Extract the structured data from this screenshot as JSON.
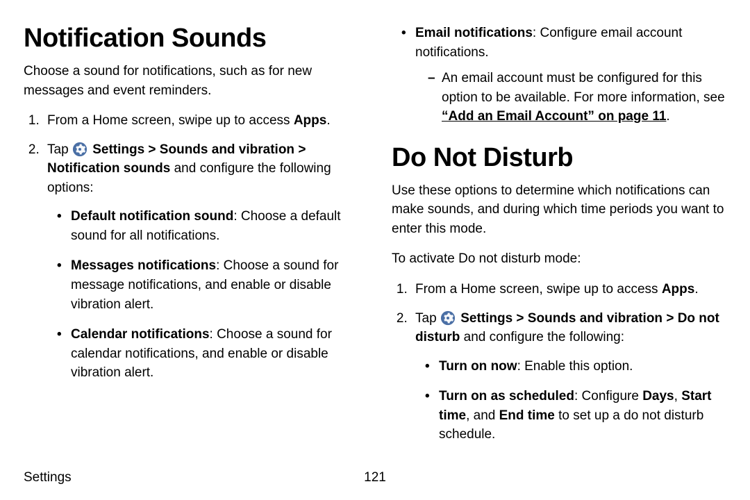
{
  "left": {
    "title": "Notification Sounds",
    "intro": "Choose a sound for notifications, such as for new messages and event reminders.",
    "step1_a": "From a Home screen, swipe up to access ",
    "step1_b": "Apps",
    "step1_c": ".",
    "step2_a": "Tap ",
    "step2_b": "Settings > Sounds and vibration > Notification sounds",
    "step2_c": " and configure the following options:",
    "b1_a": "Default notification sound",
    "b1_b": ": Choose a default sound for all notifications.",
    "b2_a": "Messages notifications",
    "b2_b": ": Choose a sound for message notifications, and enable or disable vibration alert.",
    "b3_a": "Calendar notifications",
    "b3_b": ": Choose a sound for calendar notifications, and enable or disable vibration alert."
  },
  "right": {
    "b4_a": "Email notifications",
    "b4_b": ": Configure email account notifications.",
    "dash_a": "An email account must be configured for this option to be available. For more information, see ",
    "dash_b": "“Add an Email Account” on page 11",
    "dash_c": ".",
    "title2": "Do Not Disturb",
    "intro2": "Use these options to determine which notifications can make sounds, and during which time periods you want to enter this mode.",
    "activate": "To activate Do not disturb mode:",
    "step1_a": "From a Home screen, swipe up to access ",
    "step1_b": "Apps",
    "step1_c": ".",
    "step2_a": "Tap ",
    "step2_b": "Settings > Sounds and vibration > Do not disturb",
    "step2_c": " and configure the following:",
    "b5_a": "Turn on now",
    "b5_b": ": Enable this option.",
    "b6_a": "Turn on as scheduled",
    "b6_b": ": Configure ",
    "b6_c": "Days",
    "b6_d": ", ",
    "b6_e": "Start time",
    "b6_f": ", and ",
    "b6_g": "End time",
    "b6_h": " to set up a do not disturb schedule."
  },
  "footer": {
    "section": "Settings",
    "page": "121"
  }
}
